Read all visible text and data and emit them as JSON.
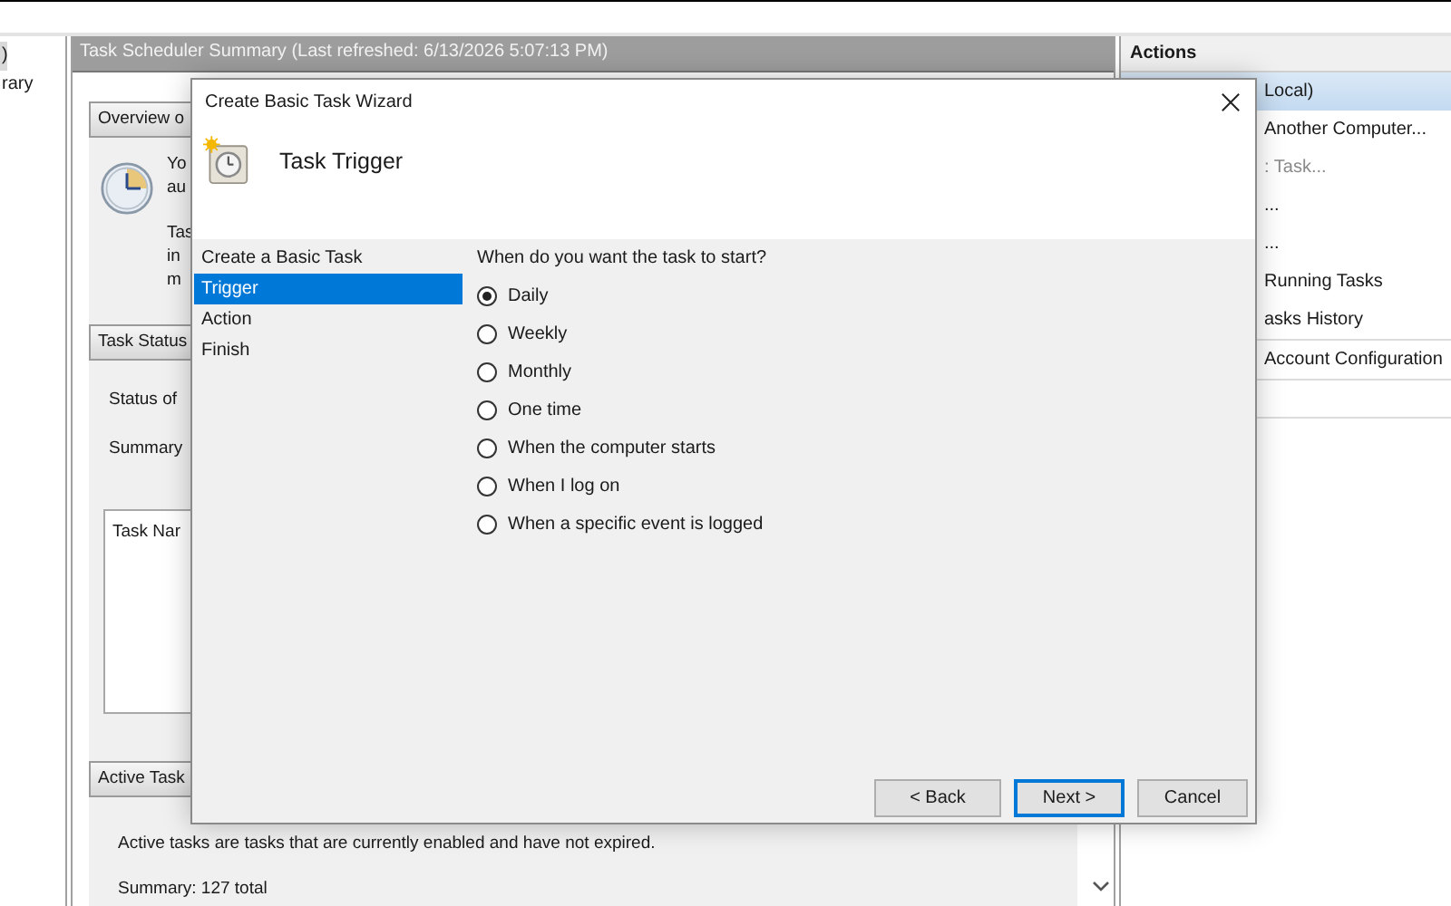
{
  "tree": {
    "items": [
      {
        "label": ")",
        "selected": true
      },
      {
        "label": "rary",
        "selected": false
      }
    ]
  },
  "summary": {
    "title": "Task Scheduler Summary (Last refreshed: 6/13/2026 5:07:13 PM)",
    "overview": {
      "header": "Overview o",
      "paragraphs": [
        [
          "Yo",
          "au"
        ],
        [
          "Tas",
          "in",
          "m"
        ]
      ]
    },
    "task_status": {
      "header": "Task Status",
      "status_label": "Status of",
      "summary_label": "Summary",
      "table_header": "Task Nar"
    },
    "active_tasks": {
      "header": "Active Task",
      "description": "Active tasks are tasks that are currently enabled and have not expired.",
      "summary": "Summary: 127 total"
    }
  },
  "actions": {
    "title": "Actions",
    "items": [
      {
        "label": "Local)",
        "selected": true,
        "disabled": false,
        "section_start": false
      },
      {
        "label": "Another Computer...",
        "selected": false,
        "disabled": false,
        "section_start": false
      },
      {
        "label": ": Task...",
        "selected": false,
        "disabled": true,
        "section_start": false
      },
      {
        "label": "...",
        "selected": false,
        "disabled": false,
        "section_start": false
      },
      {
        "label": "...",
        "selected": false,
        "disabled": false,
        "section_start": false
      },
      {
        "label": "Running Tasks",
        "selected": false,
        "disabled": false,
        "section_start": false
      },
      {
        "label": "asks History",
        "selected": false,
        "disabled": false,
        "section_start": false
      },
      {
        "label": "Account Configuration",
        "selected": false,
        "disabled": false,
        "section_start": true
      }
    ]
  },
  "dialog": {
    "title": "Create Basic Task Wizard",
    "heading": "Task Trigger",
    "steps": [
      {
        "label": "Create a Basic Task",
        "selected": false
      },
      {
        "label": "Trigger",
        "selected": true
      },
      {
        "label": "Action",
        "selected": false
      },
      {
        "label": "Finish",
        "selected": false
      }
    ],
    "question": "When do you want the task to start?",
    "options": [
      {
        "label": "Daily",
        "selected": true
      },
      {
        "label": "Weekly",
        "selected": false
      },
      {
        "label": "Monthly",
        "selected": false
      },
      {
        "label": "One time",
        "selected": false
      },
      {
        "label": "When the computer starts",
        "selected": false
      },
      {
        "label": "When I log on",
        "selected": false
      },
      {
        "label": "When a specific event is logged",
        "selected": false
      }
    ],
    "buttons": [
      {
        "label": "< Back",
        "focused": false
      },
      {
        "label": "Next >",
        "focused": true
      },
      {
        "label": "Cancel",
        "focused": false
      }
    ]
  }
}
